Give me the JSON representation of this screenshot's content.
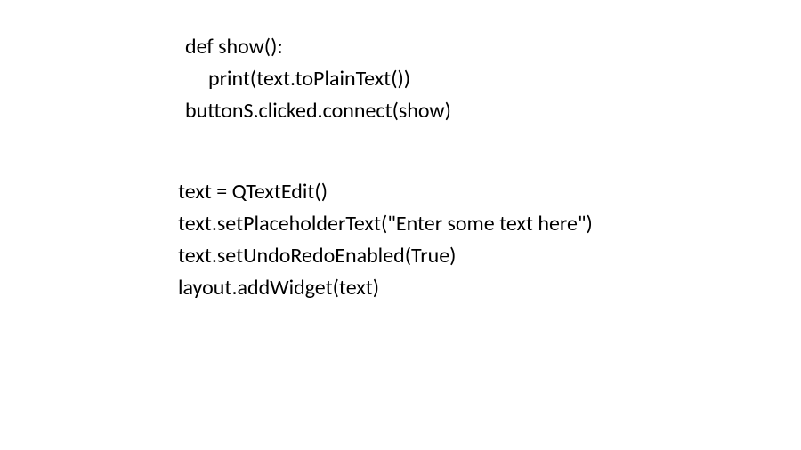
{
  "block1": {
    "line1": "def show():",
    "line2": "print(text.toPlainText())",
    "line3": "",
    "line4": "buttonS.clicked.connect(show)"
  },
  "block2": {
    "line1": "text = QTextEdit()",
    "line2": "text.setPlaceholderText(\"Enter some text here\")",
    "line3": "text.setUndoRedoEnabled(True)",
    "line4": "layout.addWidget(text)"
  }
}
